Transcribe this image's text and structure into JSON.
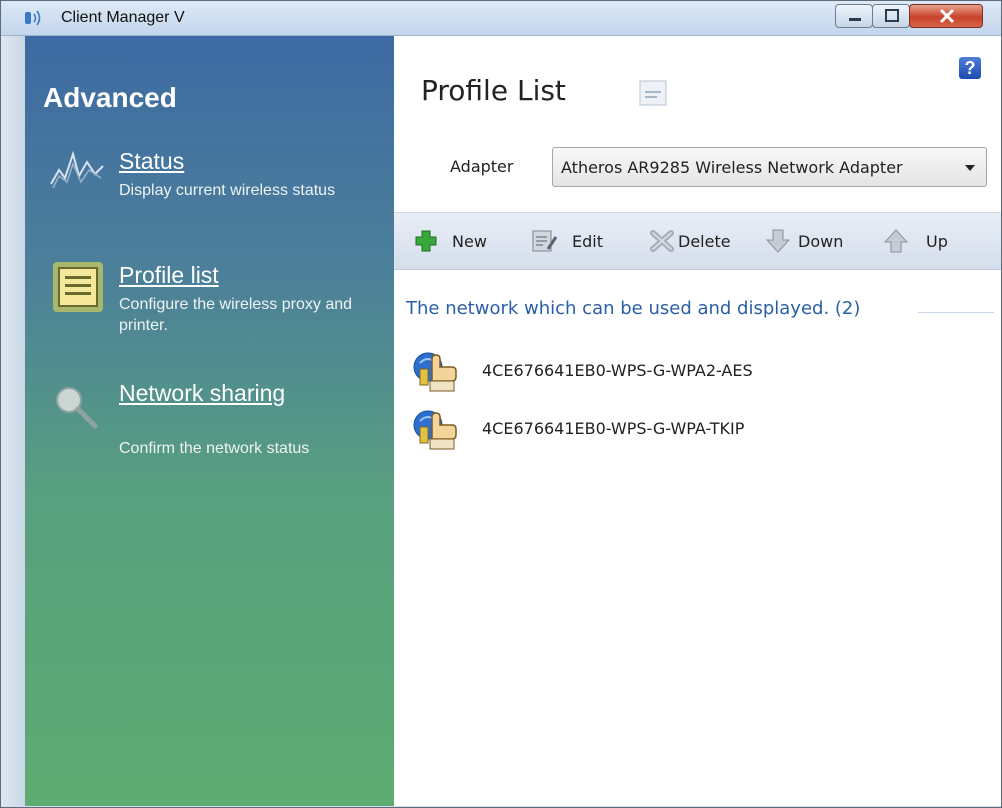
{
  "window": {
    "title": "Client Manager V"
  },
  "sidebar": {
    "heading": "Advanced",
    "items": [
      {
        "label": "Status",
        "description": "Display current wireless status",
        "icon": "status-graph-icon"
      },
      {
        "label": "Profile list",
        "description": "Configure the wireless proxy and printer.",
        "icon": "profile-list-icon"
      },
      {
        "label": "Network sharing",
        "description": "Confirm the network status",
        "icon": "magnifier-icon"
      }
    ]
  },
  "main": {
    "title": "Profile List",
    "adapter_label": "Adapter",
    "adapter_value": "Atheros AR9285 Wireless Network Adapter",
    "toolbar": {
      "new": "New",
      "edit": "Edit",
      "delete": "Delete",
      "down": "Down",
      "up": "Up"
    },
    "section_header": "The network which can be used and displayed. (2)",
    "profiles": [
      {
        "name": "4CE676641EB0-WPS-G-WPA2-AES"
      },
      {
        "name": "4CE676641EB0-WPS-G-WPA-TKIP"
      }
    ],
    "help": "?"
  },
  "colors": {
    "sidebar_top": "#3d6aa3",
    "sidebar_bottom": "#5eac72",
    "link_blue": "#2a5fa8"
  }
}
